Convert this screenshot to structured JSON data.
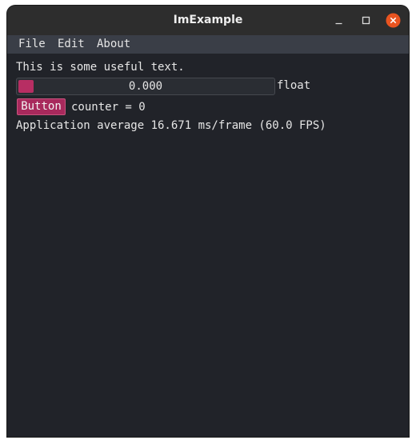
{
  "window": {
    "title": "ImExample",
    "controls": {
      "minimize": "minimize-icon",
      "maximize": "maximize-icon",
      "close": "close-icon"
    },
    "colors": {
      "titlebar": "#2d2d2d",
      "background": "#212329",
      "close_button": "#e95420"
    }
  },
  "menubar": {
    "items": [
      {
        "label": "File"
      },
      {
        "label": "Edit"
      },
      {
        "label": "About"
      }
    ]
  },
  "main": {
    "text": "This is some useful text.",
    "slider": {
      "value": "0.000",
      "label": "float",
      "fraction": 0.0
    },
    "button": {
      "label": "Button"
    },
    "counter_text": "counter = 0",
    "stats_text": "Application average 16.671 ms/frame (60.0 FPS)",
    "colors": {
      "accent": "#b72e63",
      "text": "#e6e6e6"
    }
  }
}
